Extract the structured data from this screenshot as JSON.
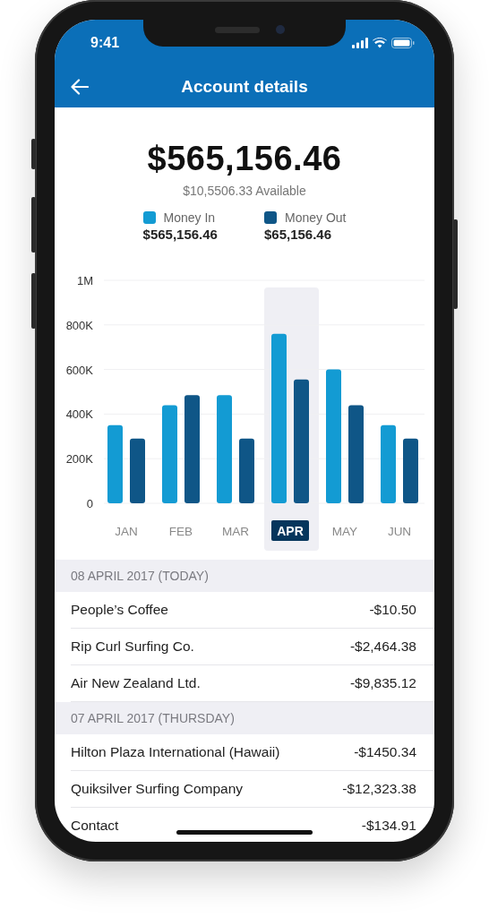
{
  "status_bar": {
    "time": "9:41"
  },
  "nav": {
    "title": "Account details"
  },
  "summary": {
    "balance": "$565,156.46",
    "available": "$10,5506.33 Available",
    "totals": [
      "$565,156.46",
      "$65,156.46"
    ]
  },
  "chart_data": {
    "type": "bar",
    "categories": [
      "JAN",
      "FEB",
      "MAR",
      "APR",
      "MAY",
      "JUN"
    ],
    "series": [
      {
        "name": "Money In",
        "color": "#139bd3",
        "values": [
          350000,
          440000,
          485000,
          760000,
          600000,
          350000
        ]
      },
      {
        "name": "Money Out",
        "color": "#0f5687",
        "values": [
          290000,
          485000,
          290000,
          555000,
          440000,
          290000
        ]
      }
    ],
    "ylim": [
      0,
      1000000
    ],
    "yticks": [
      {
        "value": 0,
        "label": "0"
      },
      {
        "value": 200000,
        "label": "200K"
      },
      {
        "value": 400000,
        "label": "400K"
      },
      {
        "value": 600000,
        "label": "600K"
      },
      {
        "value": 800000,
        "label": "800K"
      },
      {
        "value": 1000000,
        "label": "1M"
      }
    ],
    "grid": true
  },
  "month_tabs": [
    {
      "selected": false
    },
    {
      "selected": false
    },
    {
      "selected": false
    },
    {
      "selected": true
    },
    {
      "selected": false
    },
    {
      "selected": false
    }
  ],
  "sections": [
    {
      "title": "08 APRIL 2017 (TODAY)",
      "rows": [
        {
          "name": "People’s Coffee",
          "amount": "-$10.50"
        },
        {
          "name": "Rip Curl Surfing Co.",
          "amount": "-$2,464.38"
        },
        {
          "name": "Air New Zealand Ltd.",
          "amount": "-$9,835.12"
        }
      ]
    },
    {
      "title": "07 APRIL 2017 (THURSDAY)",
      "rows": [
        {
          "name": "Hilton Plaza International (Hawaii)",
          "amount": "-$1450.34"
        },
        {
          "name": "Quiksilver Surfing Company",
          "amount": "-$12,323.38"
        },
        {
          "name": "Contact",
          "amount": "-$134.91"
        }
      ]
    }
  ]
}
